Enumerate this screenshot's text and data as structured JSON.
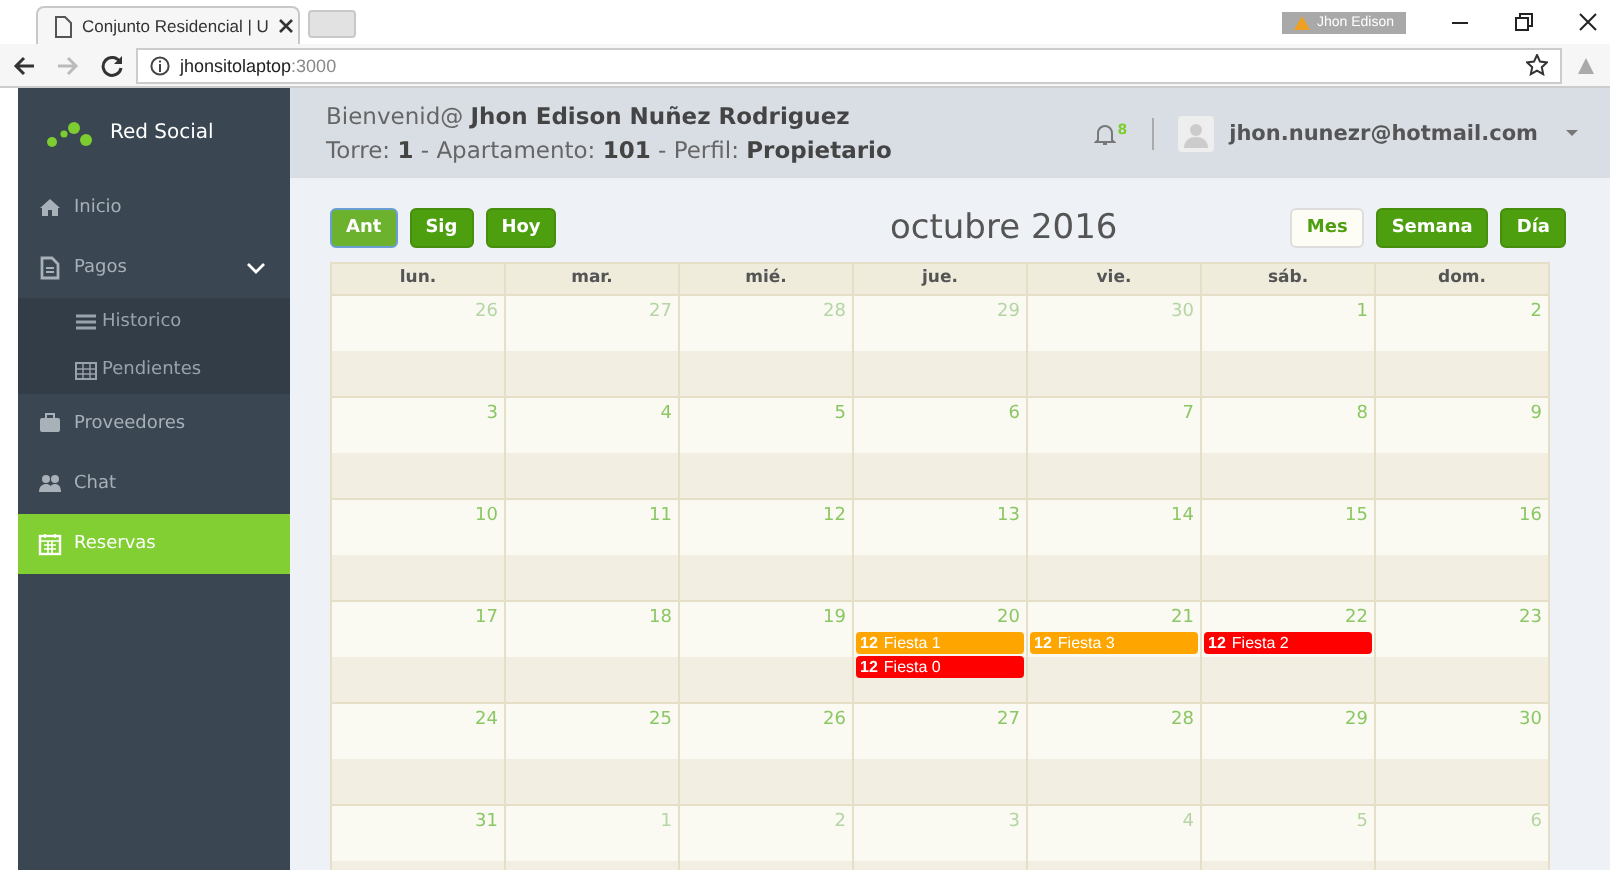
{
  "browser": {
    "tab_title": "Conjunto Residencial | U",
    "profile": "Jhon Edison",
    "address_host": "jhonsitolaptop",
    "address_port": ":3000"
  },
  "sidebar": {
    "brand": "Red Social",
    "items": [
      {
        "label": "Inicio",
        "selected": false
      },
      {
        "label": "Pagos",
        "selected": false,
        "expanded": true,
        "children": [
          {
            "label": "Historico",
            "selected": false
          },
          {
            "label": "Pendientes",
            "selected": false
          }
        ]
      },
      {
        "label": "Proveedores",
        "selected": false
      },
      {
        "label": "Chat",
        "selected": false
      },
      {
        "label": "Reservas",
        "selected": true
      }
    ]
  },
  "header": {
    "welcome": "Bienvenid@ **Jhon Edison Nuñez Rodriguez**",
    "details": "Torre: **1** - Apartamento: **101** - Perfil: **Propietario**",
    "notifications": "8",
    "email": "jhon.nunezr@hotmail.com"
  },
  "calendar": {
    "nav_buttons": [
      {
        "label": "Ant",
        "selected": true
      },
      {
        "label": "Sig",
        "selected": false
      },
      {
        "label": "Hoy",
        "selected": false
      }
    ],
    "title": "octubre 2016",
    "views": [
      {
        "label": "Mes",
        "selected": true
      },
      {
        "label": "Semana",
        "selected": false
      },
      {
        "label": "Día",
        "selected": false
      }
    ],
    "weekdays": [
      "lun.",
      "mar.",
      "mié.",
      "jue.",
      "vie.",
      "sáb.",
      "dom."
    ],
    "weeks": [
      [
        {
          "day": "26",
          "other_month": true
        },
        {
          "day": "27",
          "other_month": true
        },
        {
          "day": "28",
          "other_month": true
        },
        {
          "day": "29",
          "other_month": true
        },
        {
          "day": "30",
          "other_month": true
        },
        {
          "day": "1",
          "other_month": false
        },
        {
          "day": "2",
          "other_month": false
        }
      ],
      [
        {
          "day": "3",
          "other_month": false
        },
        {
          "day": "4",
          "other_month": false
        },
        {
          "day": "5",
          "other_month": false
        },
        {
          "day": "6",
          "other_month": false
        },
        {
          "day": "7",
          "other_month": false
        },
        {
          "day": "8",
          "other_month": false
        },
        {
          "day": "9",
          "other_month": false
        }
      ],
      [
        {
          "day": "10",
          "other_month": false
        },
        {
          "day": "11",
          "other_month": false
        },
        {
          "day": "12",
          "other_month": false
        },
        {
          "day": "13",
          "other_month": false
        },
        {
          "day": "14",
          "other_month": false
        },
        {
          "day": "15",
          "other_month": false
        },
        {
          "day": "16",
          "other_month": false
        }
      ],
      [
        {
          "day": "17",
          "other_month": false
        },
        {
          "day": "18",
          "other_month": false
        },
        {
          "day": "19",
          "other_month": false
        },
        {
          "day": "20",
          "other_month": false,
          "events": [
            {
              "time": "12",
              "title": "Fiesta 1",
              "color": "#ffa500"
            },
            {
              "time": "12",
              "title": "Fiesta 0",
              "color": "#ff0000"
            }
          ]
        },
        {
          "day": "21",
          "other_month": false,
          "events": [
            {
              "time": "12",
              "title": "Fiesta 3",
              "color": "#ffa500"
            }
          ]
        },
        {
          "day": "22",
          "other_month": false,
          "events": [
            {
              "time": "12",
              "title": "Fiesta 2",
              "color": "#ff0000"
            }
          ]
        },
        {
          "day": "23",
          "other_month": false
        }
      ],
      [
        {
          "day": "24",
          "other_month": false
        },
        {
          "day": "25",
          "other_month": false
        },
        {
          "day": "26",
          "other_month": false
        },
        {
          "day": "27",
          "other_month": false
        },
        {
          "day": "28",
          "other_month": false
        },
        {
          "day": "29",
          "other_month": false
        },
        {
          "day": "30",
          "other_month": false
        }
      ],
      [
        {
          "day": "31",
          "other_month": false
        },
        {
          "day": "1",
          "other_month": true
        },
        {
          "day": "2",
          "other_month": true
        },
        {
          "day": "3",
          "other_month": true
        },
        {
          "day": "4",
          "other_month": true
        },
        {
          "day": "5",
          "other_month": true
        },
        {
          "day": "6",
          "other_month": true
        }
      ]
    ]
  }
}
